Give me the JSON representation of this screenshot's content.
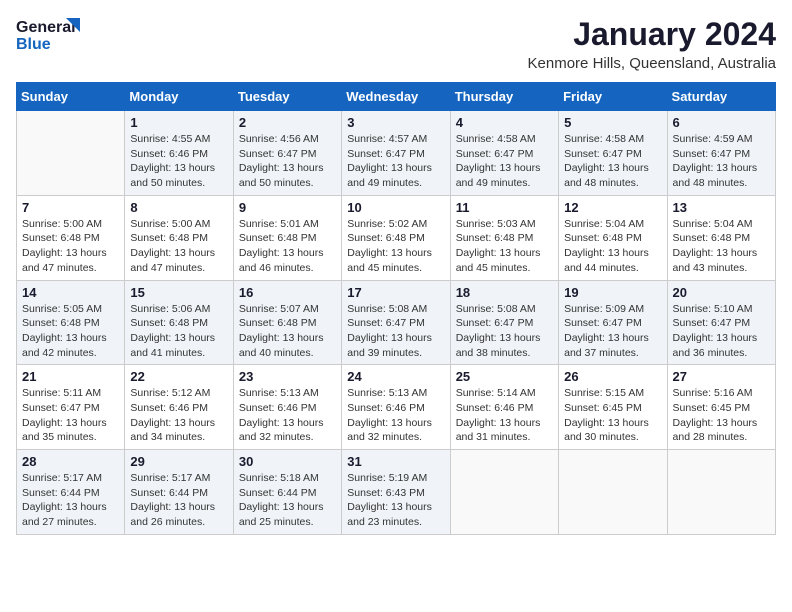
{
  "logo": {
    "line1": "General",
    "line2": "Blue"
  },
  "title": "January 2024",
  "subtitle": "Kenmore Hills, Queensland, Australia",
  "days_of_week": [
    "Sunday",
    "Monday",
    "Tuesday",
    "Wednesday",
    "Thursday",
    "Friday",
    "Saturday"
  ],
  "weeks": [
    [
      {
        "day": "",
        "detail": ""
      },
      {
        "day": "1",
        "detail": "Sunrise: 4:55 AM\nSunset: 6:46 PM\nDaylight: 13 hours\nand 50 minutes."
      },
      {
        "day": "2",
        "detail": "Sunrise: 4:56 AM\nSunset: 6:47 PM\nDaylight: 13 hours\nand 50 minutes."
      },
      {
        "day": "3",
        "detail": "Sunrise: 4:57 AM\nSunset: 6:47 PM\nDaylight: 13 hours\nand 49 minutes."
      },
      {
        "day": "4",
        "detail": "Sunrise: 4:58 AM\nSunset: 6:47 PM\nDaylight: 13 hours\nand 49 minutes."
      },
      {
        "day": "5",
        "detail": "Sunrise: 4:58 AM\nSunset: 6:47 PM\nDaylight: 13 hours\nand 48 minutes."
      },
      {
        "day": "6",
        "detail": "Sunrise: 4:59 AM\nSunset: 6:47 PM\nDaylight: 13 hours\nand 48 minutes."
      }
    ],
    [
      {
        "day": "7",
        "detail": "Sunrise: 5:00 AM\nSunset: 6:48 PM\nDaylight: 13 hours\nand 47 minutes."
      },
      {
        "day": "8",
        "detail": "Sunrise: 5:00 AM\nSunset: 6:48 PM\nDaylight: 13 hours\nand 47 minutes."
      },
      {
        "day": "9",
        "detail": "Sunrise: 5:01 AM\nSunset: 6:48 PM\nDaylight: 13 hours\nand 46 minutes."
      },
      {
        "day": "10",
        "detail": "Sunrise: 5:02 AM\nSunset: 6:48 PM\nDaylight: 13 hours\nand 45 minutes."
      },
      {
        "day": "11",
        "detail": "Sunrise: 5:03 AM\nSunset: 6:48 PM\nDaylight: 13 hours\nand 45 minutes."
      },
      {
        "day": "12",
        "detail": "Sunrise: 5:04 AM\nSunset: 6:48 PM\nDaylight: 13 hours\nand 44 minutes."
      },
      {
        "day": "13",
        "detail": "Sunrise: 5:04 AM\nSunset: 6:48 PM\nDaylight: 13 hours\nand 43 minutes."
      }
    ],
    [
      {
        "day": "14",
        "detail": "Sunrise: 5:05 AM\nSunset: 6:48 PM\nDaylight: 13 hours\nand 42 minutes."
      },
      {
        "day": "15",
        "detail": "Sunrise: 5:06 AM\nSunset: 6:48 PM\nDaylight: 13 hours\nand 41 minutes."
      },
      {
        "day": "16",
        "detail": "Sunrise: 5:07 AM\nSunset: 6:48 PM\nDaylight: 13 hours\nand 40 minutes."
      },
      {
        "day": "17",
        "detail": "Sunrise: 5:08 AM\nSunset: 6:47 PM\nDaylight: 13 hours\nand 39 minutes."
      },
      {
        "day": "18",
        "detail": "Sunrise: 5:08 AM\nSunset: 6:47 PM\nDaylight: 13 hours\nand 38 minutes."
      },
      {
        "day": "19",
        "detail": "Sunrise: 5:09 AM\nSunset: 6:47 PM\nDaylight: 13 hours\nand 37 minutes."
      },
      {
        "day": "20",
        "detail": "Sunrise: 5:10 AM\nSunset: 6:47 PM\nDaylight: 13 hours\nand 36 minutes."
      }
    ],
    [
      {
        "day": "21",
        "detail": "Sunrise: 5:11 AM\nSunset: 6:47 PM\nDaylight: 13 hours\nand 35 minutes."
      },
      {
        "day": "22",
        "detail": "Sunrise: 5:12 AM\nSunset: 6:46 PM\nDaylight: 13 hours\nand 34 minutes."
      },
      {
        "day": "23",
        "detail": "Sunrise: 5:13 AM\nSunset: 6:46 PM\nDaylight: 13 hours\nand 32 minutes."
      },
      {
        "day": "24",
        "detail": "Sunrise: 5:13 AM\nSunset: 6:46 PM\nDaylight: 13 hours\nand 32 minutes."
      },
      {
        "day": "25",
        "detail": "Sunrise: 5:14 AM\nSunset: 6:46 PM\nDaylight: 13 hours\nand 31 minutes."
      },
      {
        "day": "26",
        "detail": "Sunrise: 5:15 AM\nSunset: 6:45 PM\nDaylight: 13 hours\nand 30 minutes."
      },
      {
        "day": "27",
        "detail": "Sunrise: 5:16 AM\nSunset: 6:45 PM\nDaylight: 13 hours\nand 28 minutes."
      }
    ],
    [
      {
        "day": "28",
        "detail": "Sunrise: 5:17 AM\nSunset: 6:44 PM\nDaylight: 13 hours\nand 27 minutes."
      },
      {
        "day": "29",
        "detail": "Sunrise: 5:17 AM\nSunset: 6:44 PM\nDaylight: 13 hours\nand 26 minutes."
      },
      {
        "day": "30",
        "detail": "Sunrise: 5:18 AM\nSunset: 6:44 PM\nDaylight: 13 hours\nand 25 minutes."
      },
      {
        "day": "31",
        "detail": "Sunrise: 5:19 AM\nSunset: 6:43 PM\nDaylight: 13 hours\nand 23 minutes."
      },
      {
        "day": "",
        "detail": ""
      },
      {
        "day": "",
        "detail": ""
      },
      {
        "day": "",
        "detail": ""
      }
    ]
  ]
}
